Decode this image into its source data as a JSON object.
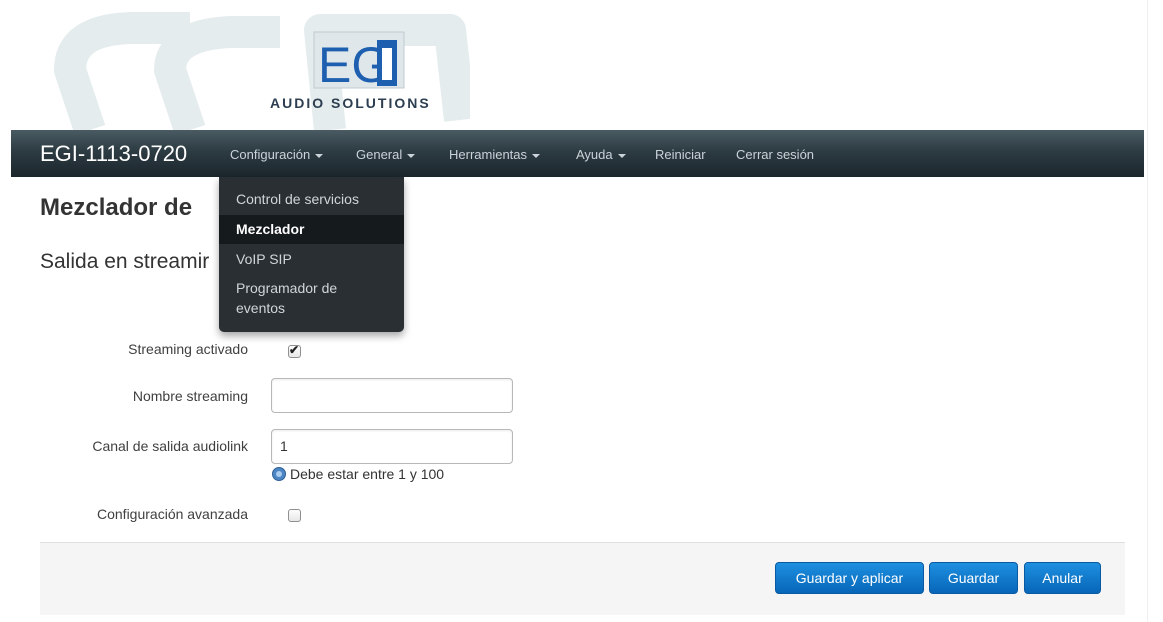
{
  "header": {
    "logo_text": "EGi",
    "logo_subtitle": "AUDIO SOLUTIONS",
    "watermark_text": "EGi"
  },
  "navbar": {
    "brand": "EGI-1113-0720",
    "menus": [
      {
        "label": "Configuración",
        "has_caret": true
      },
      {
        "label": "General",
        "has_caret": true
      },
      {
        "label": "Herramientas",
        "has_caret": true
      },
      {
        "label": "Ayuda",
        "has_caret": true
      },
      {
        "label": "Reiniciar",
        "has_caret": false
      },
      {
        "label": "Cerrar sesión",
        "has_caret": false
      }
    ]
  },
  "dropdown": {
    "items": [
      {
        "label": "Control de servicios",
        "active": false
      },
      {
        "label": "Mezclador",
        "active": true
      },
      {
        "label": "VoIP SIP",
        "active": false
      },
      {
        "label": "Programador de",
        "label2": "eventos",
        "active": false
      }
    ]
  },
  "page": {
    "title": "Mezclador de",
    "section": "Salida en streamir"
  },
  "form": {
    "streaming_enabled_label": "Streaming activado",
    "streaming_enabled_checked": true,
    "stream_name_label": "Nombre streaming",
    "stream_name_value": "",
    "audiolink_channel_label": "Canal de salida audiolink",
    "audiolink_channel_value": "1",
    "audiolink_channel_help": "Debe estar entre 1 y 100",
    "advanced_label": "Configuración avanzada",
    "advanced_checked": false
  },
  "actions": {
    "save_apply": "Guardar y aplicar",
    "save": "Guardar",
    "cancel": "Anular"
  },
  "colors": {
    "navbar_top": "#4a5b63",
    "navbar_bottom": "#1b262c",
    "button_blue": "#0b72c6",
    "dropdown_bg": "#2a2f33"
  }
}
